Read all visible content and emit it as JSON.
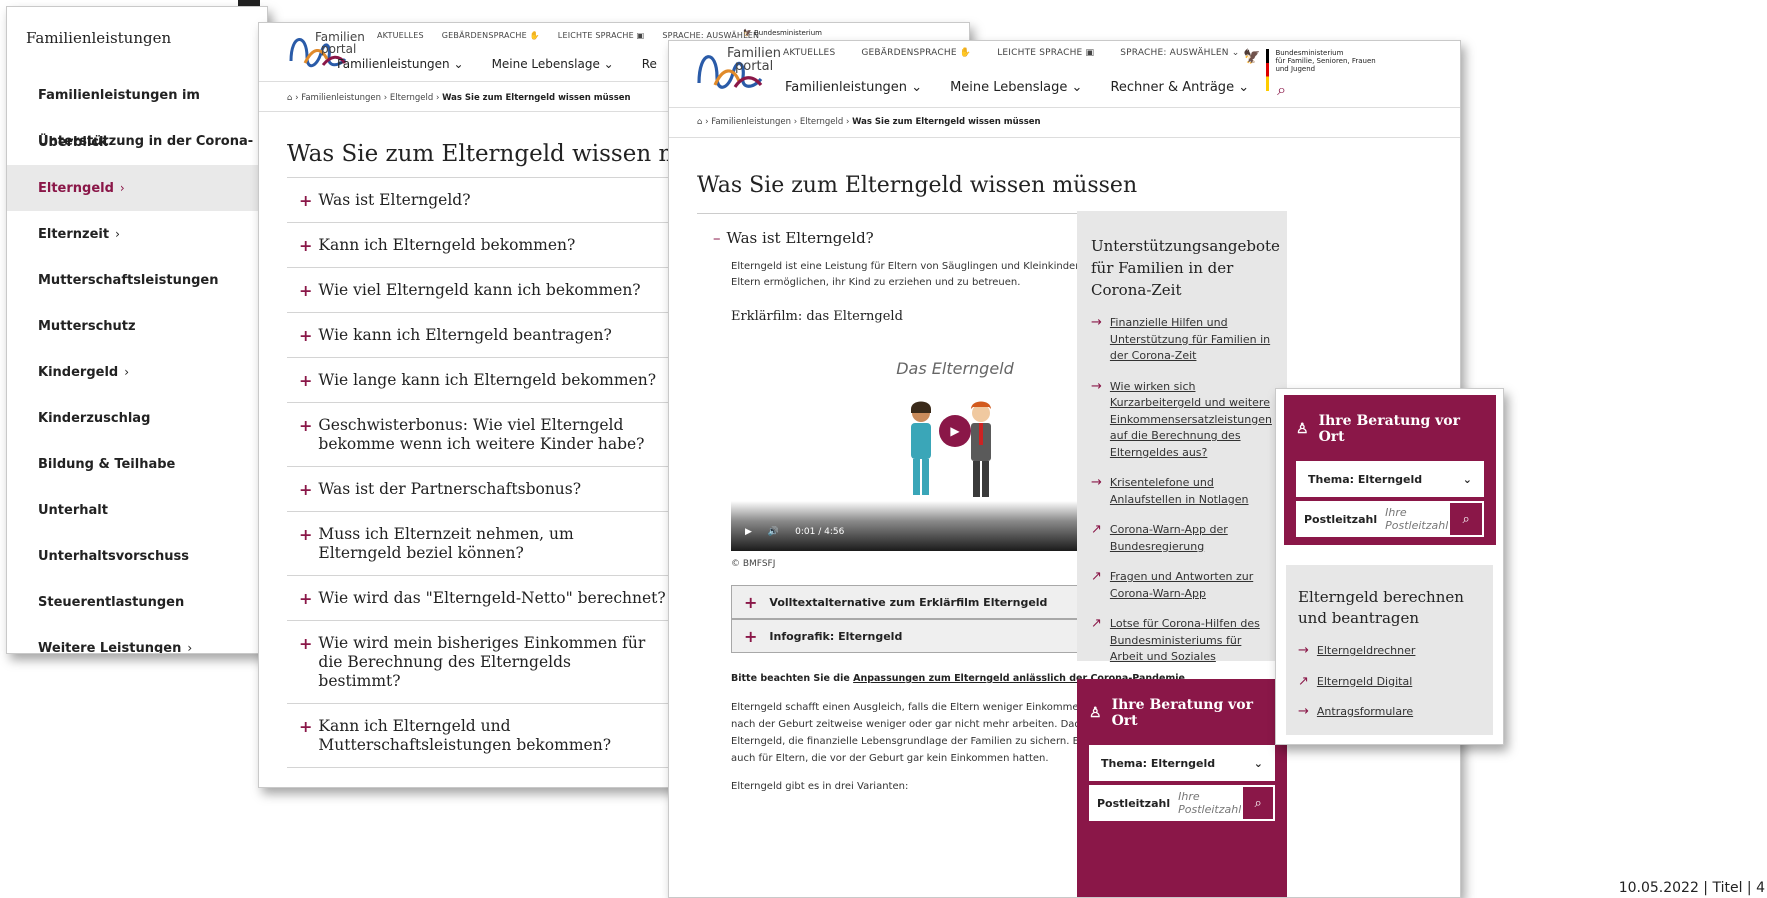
{
  "sidebar": {
    "title": "Familienleistungen",
    "items": [
      {
        "label": "Familienleistungen im Überblick",
        "chev": ""
      },
      {
        "label": "Unterstützung in der Corona-Zeit",
        "chev": "›"
      },
      {
        "label": "Elterngeld",
        "chev": "›"
      },
      {
        "label": "Elternzeit",
        "chev": "›"
      },
      {
        "label": "Mutterschaftsleistungen",
        "chev": ""
      },
      {
        "label": "Mutterschutz",
        "chev": ""
      },
      {
        "label": "Kindergeld",
        "chev": "›"
      },
      {
        "label": "Kinderzuschlag",
        "chev": ""
      },
      {
        "label": "Bildung & Teilhabe",
        "chev": ""
      },
      {
        "label": "Unterhalt",
        "chev": ""
      },
      {
        "label": "Unterhaltsvorschuss",
        "chev": ""
      },
      {
        "label": "Steuerentlastungen",
        "chev": ""
      },
      {
        "label": "Weitere Leistungen",
        "chev": "›"
      }
    ]
  },
  "logo": {
    "line1": "Familien",
    "line2": "portal"
  },
  "topnav": {
    "aktuelles": "AKTUELLES",
    "gebaerden": "GEBÄRDENSPRACHE",
    "leichte": "LEICHTE SPRACHE",
    "sprache": "SPRACHE: AUSWÄHLEN",
    "sprache_short": "SPRACHE: AUSWÄHLEN"
  },
  "ministry": {
    "line1": "Bundesministerium",
    "line2": "für Familie, Senioren, Frauen",
    "line3": "und Jugend",
    "short": "Bundesministerium"
  },
  "mainnav": {
    "item1": "Familienleistungen",
    "item2": "Meine Lebenslage",
    "item3": "Rechner & Anträge",
    "item3_short": "Re"
  },
  "breadcrumb": {
    "c1": "Familienleistungen",
    "c2": "Elterngeld",
    "c3": "Was Sie zum Elterngeld wissen müssen"
  },
  "middle": {
    "heading": "Was Sie zum Elterngeld wissen müsse",
    "questions": [
      "Was ist Elterngeld?",
      "Kann ich Elterngeld bekommen?",
      "Wie viel Elterngeld kann ich bekommen?",
      "Wie kann ich Elterngeld beantragen?",
      "Wie lange kann ich Elterngeld bekommen?",
      "Geschwisterbonus: Wie viel Elterngeld bekomme wenn ich weitere Kinder habe?",
      "Was ist der Partnerschaftsbonus?",
      "Muss ich Elternzeit nehmen, um Elterngeld beziel können?",
      "Wie wird das \"Elterngeld-Netto\" berechnet?",
      "Wie wird mein bisheriges Einkommen für die Berechnung des Elterngelds bestimmt?",
      "Kann ich Elterngeld und Mutterschaftsleistungen bekommen?"
    ]
  },
  "front": {
    "heading": "Was Sie zum Elterngeld wissen müssen",
    "question": "Was ist Elterngeld?",
    "intro": "Elterngeld ist eine Leistung für Eltern von Säuglingen und Kleinkindern. Es soll den Eltern ermöglichen, ihr Kind zu erziehen und zu betreuen.",
    "subheading": "Erklärfilm: das Elterngeld",
    "video_title": "Das Elterngeld",
    "video_time": "0:01",
    "video_sep": "/",
    "video_duration": "4:56",
    "copyright": "© BMFSFJ",
    "acc1": "Volltextalternative zum Erklärfilm Elterngeld",
    "acc2": "Infografik: Elterngeld",
    "note_prefix": "Bitte beachten Sie die ",
    "note_link": "Anpassungen zum Elterngeld anlässlich der Corona-Pandemie",
    "note_suffix": ".",
    "para": "Elterngeld schafft einen Ausgleich, falls die Eltern weniger Einkommen haben, weil sie nach der Geburt zeitweise weniger oder gar nicht mehr arbeiten. Dadurch hilft das Elterngeld, die finanzielle Lebensgrundlage der Familien zu sichern. Elterngeld gibt es auch für Eltern, die vor der Geburt gar kein Einkommen hatten.",
    "para2": "Elterngeld gibt es in drei Varianten:"
  },
  "sidebox": {
    "heading": "Unterstützungsangebote für Familien in der Corona-Zeit",
    "links": [
      {
        "arrow": "→",
        "text": "Finanzielle Hilfen und Unterstützung für Familien in der Corona-Zeit"
      },
      {
        "arrow": "→",
        "text": "Wie wirken sich Kurzarbeitergeld und weitere Einkommensersatzleistungen auf die Berechnung des Elterngeldes aus?"
      },
      {
        "arrow": "→",
        "text": "Krisentelefone und Anlaufstellen in Notlagen"
      },
      {
        "arrow": "↗",
        "text": "Corona-Warn-App der Bundesregierung"
      },
      {
        "arrow": "↗",
        "text": "Fragen und Antworten zur Corona-Warn-App"
      },
      {
        "arrow": "↗",
        "text": "Lotse für Corona-Hilfen des Bundesministeriums für Arbeit und Soziales"
      }
    ]
  },
  "beratung": {
    "heading": "Ihre Beratung vor Ort",
    "thema": "Thema: Elterngeld",
    "plz_label": "Postleitzahl",
    "plz_placeholder": "Ihre Postleitzahl"
  },
  "calc": {
    "heading": "Elterngeld berechnen und beantragen",
    "links": [
      {
        "arrow": "→",
        "text": "Elterngeldrechner"
      },
      {
        "arrow": "↗",
        "text": "Elterngeld Digital"
      },
      {
        "arrow": "→",
        "text": "Antragsformulare"
      }
    ]
  },
  "footer": {
    "text": "10.05.2022 | Titel | 4"
  },
  "colors": {
    "accent": "#8a1748",
    "grey": "#e7e7e7"
  }
}
